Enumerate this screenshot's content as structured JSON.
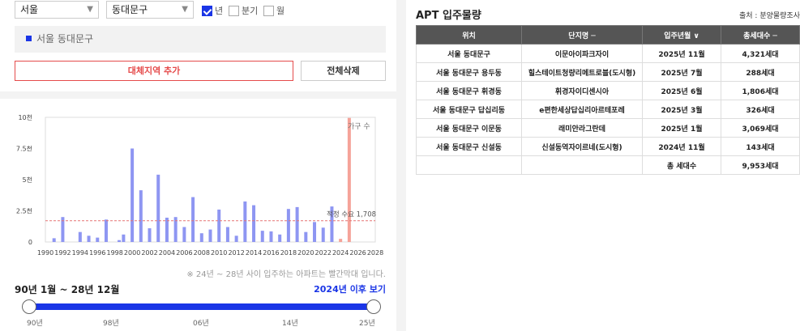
{
  "filters": {
    "city": "서울",
    "district": "동대문구",
    "periods": [
      {
        "label": "년",
        "checked": true
      },
      {
        "label": "분기",
        "checked": false
      },
      {
        "label": "월",
        "checked": false
      }
    ]
  },
  "selected_region": "서울 동대문구",
  "buttons": {
    "add": "대체지역 추가",
    "delete": "전체삭제"
  },
  "chart_data": {
    "type": "bar",
    "legend": "가구 수",
    "y_ticks": [
      "10천",
      "7.5천",
      "5천",
      "2.5천",
      "0"
    ],
    "ylim": [
      0,
      10000
    ],
    "xlim": [
      1990,
      2028
    ],
    "x_ticks": [
      "1990",
      "1992",
      "1994",
      "1996",
      "1998",
      "2000",
      "2002",
      "2004",
      "2006",
      "2008",
      "2010",
      "2012",
      "2014",
      "2016",
      "2018",
      "2020",
      "2022",
      "2024",
      "2026",
      "2028"
    ],
    "bars": [
      {
        "x": 1991,
        "value": 300
      },
      {
        "x": 1992,
        "value": 2000
      },
      {
        "x": 1994,
        "value": 800
      },
      {
        "x": 1995,
        "value": 500
      },
      {
        "x": 1996,
        "value": 350
      },
      {
        "x": 1997,
        "value": 1800
      },
      {
        "x": 1998.5,
        "value": 150
      },
      {
        "x": 1999,
        "value": 600
      },
      {
        "x": 2000,
        "value": 7500
      },
      {
        "x": 2001,
        "value": 4150
      },
      {
        "x": 2002,
        "value": 1100
      },
      {
        "x": 2003,
        "value": 5400
      },
      {
        "x": 2004,
        "value": 1950
      },
      {
        "x": 2005,
        "value": 2000
      },
      {
        "x": 2006,
        "value": 1200
      },
      {
        "x": 2007,
        "value": 3600
      },
      {
        "x": 2008,
        "value": 700
      },
      {
        "x": 2009,
        "value": 1000
      },
      {
        "x": 2010,
        "value": 2600
      },
      {
        "x": 2011,
        "value": 1200
      },
      {
        "x": 2012,
        "value": 500
      },
      {
        "x": 2013,
        "value": 3250
      },
      {
        "x": 2014,
        "value": 2950
      },
      {
        "x": 2015,
        "value": 900
      },
      {
        "x": 2016,
        "value": 850
      },
      {
        "x": 2017,
        "value": 600
      },
      {
        "x": 2018,
        "value": 2650
      },
      {
        "x": 2019,
        "value": 2800
      },
      {
        "x": 2020,
        "value": 800
      },
      {
        "x": 2021,
        "value": 1600
      },
      {
        "x": 2022,
        "value": 1150
      },
      {
        "x": 2023,
        "value": 2850
      },
      {
        "x": 2024,
        "value": 250,
        "highlight": true
      },
      {
        "x": 2025,
        "value": 9953,
        "highlight": true
      }
    ],
    "reference_line": {
      "value": 1708,
      "label": "적정 수요 1,708"
    },
    "colors": {
      "bar": "#8e96f2",
      "highlight": "#f5a399",
      "reference": "#e57373"
    }
  },
  "note": "※ 24년 ~ 28년 사이 입주하는 아파트는 빨간막대 입니다.",
  "range_label": "90년 1월 ~ 28년 12월",
  "view_after_link": "2024년 이후 보기",
  "slider_labels": [
    "90년",
    "98년",
    "06년",
    "14년",
    "25년"
  ],
  "apt": {
    "title": "APT 입주물량",
    "source": "출처 : 분양물량조사",
    "headers": [
      "위치",
      "단지명 ─",
      "입주년월 ∨",
      "총세대수 ─"
    ],
    "rows": [
      [
        "서울 동대문구",
        "이문아이파크자이",
        "2025년 11월",
        "4,321세대"
      ],
      [
        "서울 동대문구 용두동",
        "힐스테이트청량리메트로블(도시형)",
        "2025년 7월",
        "288세대"
      ],
      [
        "서울 동대문구 휘경동",
        "휘경자이디센시아",
        "2025년 6월",
        "1,806세대"
      ],
      [
        "서울 동대문구 답십리동",
        "e편한세상답십리아르테포레",
        "2025년 3월",
        "326세대"
      ],
      [
        "서울 동대문구 이문동",
        "래미안라그란데",
        "2025년 1월",
        "3,069세대"
      ],
      [
        "서울 동대문구 신설동",
        "신설동역자이르네(도시형)",
        "2024년 11월",
        "143세대"
      ]
    ],
    "total_label": "총 세대수",
    "total_value": "9,953세대"
  }
}
